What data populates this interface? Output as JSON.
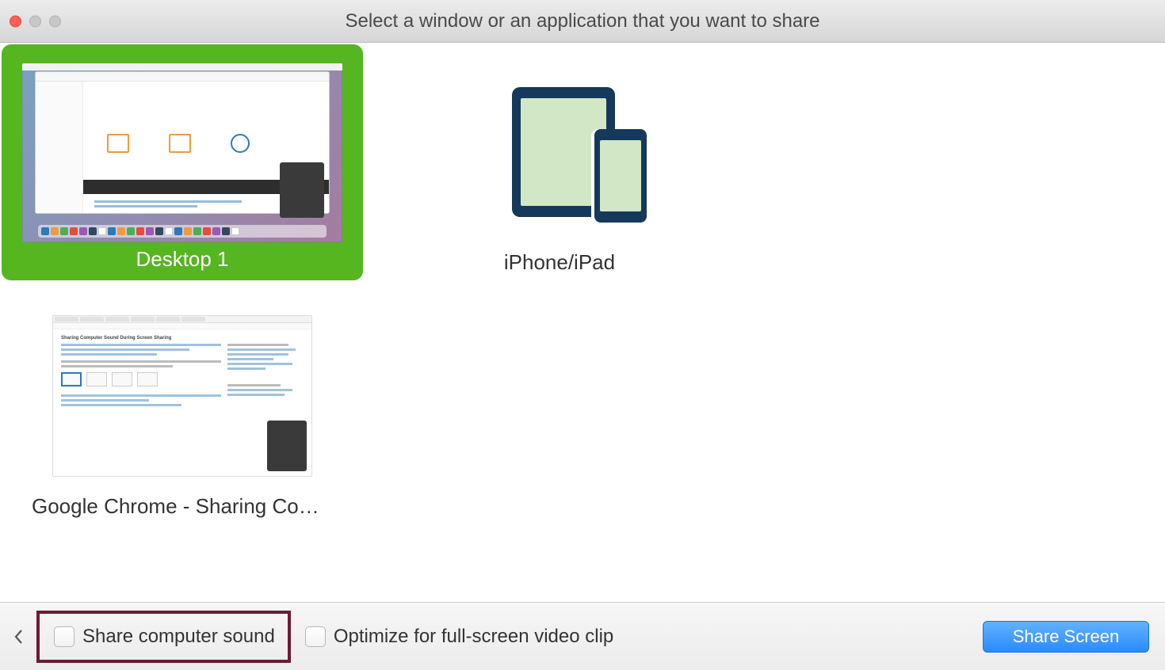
{
  "titlebar": {
    "title": "Select a window or an application that you want to share"
  },
  "options": {
    "desktop": {
      "label": "Desktop 1",
      "selected": true
    },
    "device": {
      "label": "iPhone/iPad"
    },
    "chrome": {
      "label": "Google Chrome - Sharing Co…"
    }
  },
  "footer": {
    "share_sound_label": "Share computer sound",
    "share_sound_checked": false,
    "optimize_label": "Optimize for full-screen video clip",
    "optimize_checked": false,
    "share_button_label": "Share Screen"
  }
}
